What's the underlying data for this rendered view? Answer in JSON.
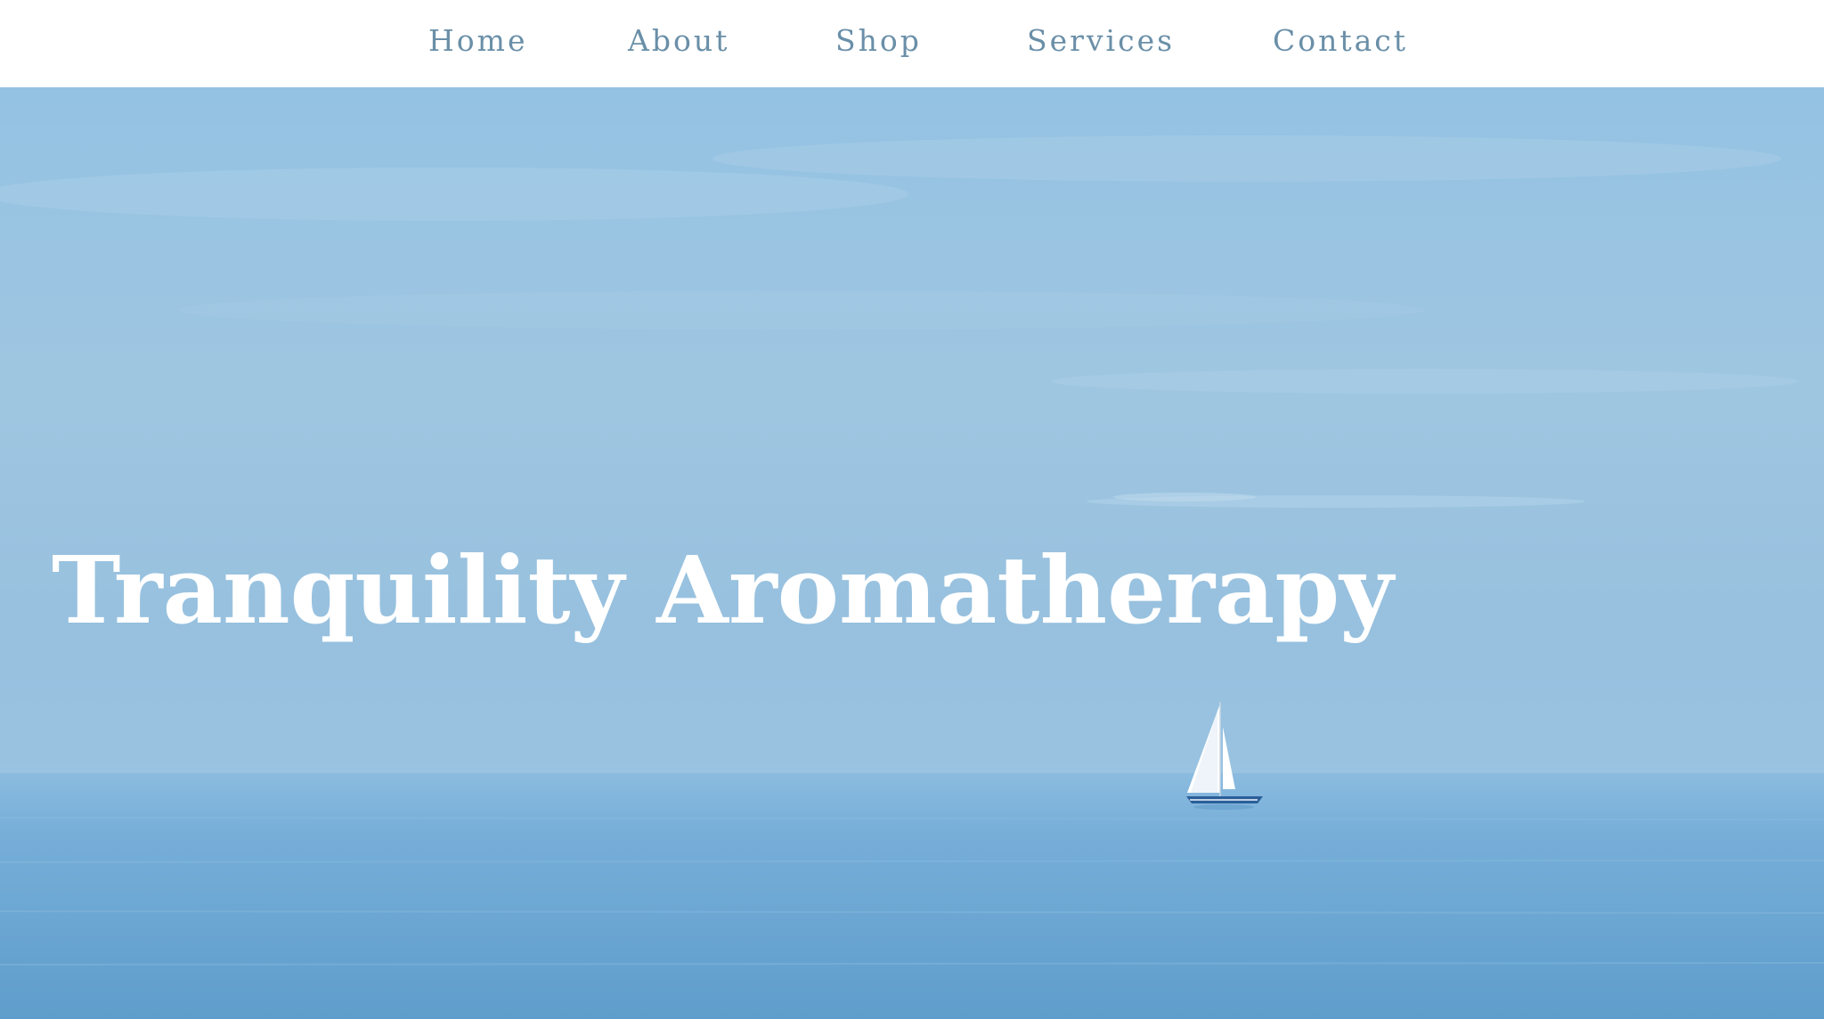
{
  "nav": {
    "items": [
      {
        "label": "Home"
      },
      {
        "label": "About"
      },
      {
        "label": "Shop"
      },
      {
        "label": "Services"
      },
      {
        "label": "Contact"
      }
    ],
    "text_color": "#6a8fa8",
    "background": "#ffffff"
  },
  "hero": {
    "title": "Tranquility Aromatherapy",
    "title_color": "#ffffff",
    "image": {
      "subject": "calm sea with a single sailboat on the horizon",
      "sky_color": "#9ec6e3",
      "sea_color": "#6aa4cf",
      "sail_color": "#ffffff",
      "hull_color": "#2a5f9a"
    }
  }
}
